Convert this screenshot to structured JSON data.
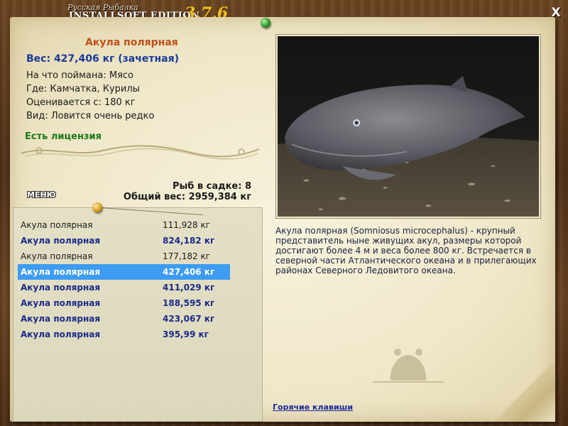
{
  "window": {
    "subtitle": "Русская Рыбалка",
    "title": "INSTALLSOFT EDITION",
    "version": "3.7.6",
    "close_label": "X"
  },
  "fish_card": {
    "name": "Акула полярная",
    "weight_line": "Вес: 427,406 кг (зачетная)",
    "caught_on": "На что поймана: Мясо",
    "where": "Где: Камчатка, Курилы",
    "rated_from": "Оценивается с: 180 кг",
    "type": "Вид: Ловится очень редко",
    "license": "Есть лицензия"
  },
  "keepnet": {
    "count_line": "Рыб в садке: 8",
    "total_line": "Общий вес: 2959,384 кг"
  },
  "menu_label": "МЕНЮ",
  "catch_list": [
    {
      "name": "Акула полярная",
      "weight": "111,928 кг",
      "style": "normal"
    },
    {
      "name": "Акула полярная",
      "weight": "824,182 кг",
      "style": "bold"
    },
    {
      "name": "Акула полярная",
      "weight": "177,182 кг",
      "style": "normal"
    },
    {
      "name": "Акула полярная",
      "weight": "427,406 кг",
      "style": "sel"
    },
    {
      "name": "Акула полярная",
      "weight": "411,029 кг",
      "style": "bold"
    },
    {
      "name": "Акула полярная",
      "weight": "188,595 кг",
      "style": "bold"
    },
    {
      "name": "Акула полярная",
      "weight": "423,067 кг",
      "style": "bold"
    },
    {
      "name": "Акула полярная",
      "weight": "395,99 кг",
      "style": "bold"
    }
  ],
  "description": "Акула полярная (Somniosus microcephalus) - крупный представитель ныне живущих акул, размеры которой достигают более 4 м и веса более 800 кг. Встречается в северной части Атлантического океана и в прилегающих районах Северного Ледовитого океана.",
  "hotkeys_label": "Горячие клавиши"
}
